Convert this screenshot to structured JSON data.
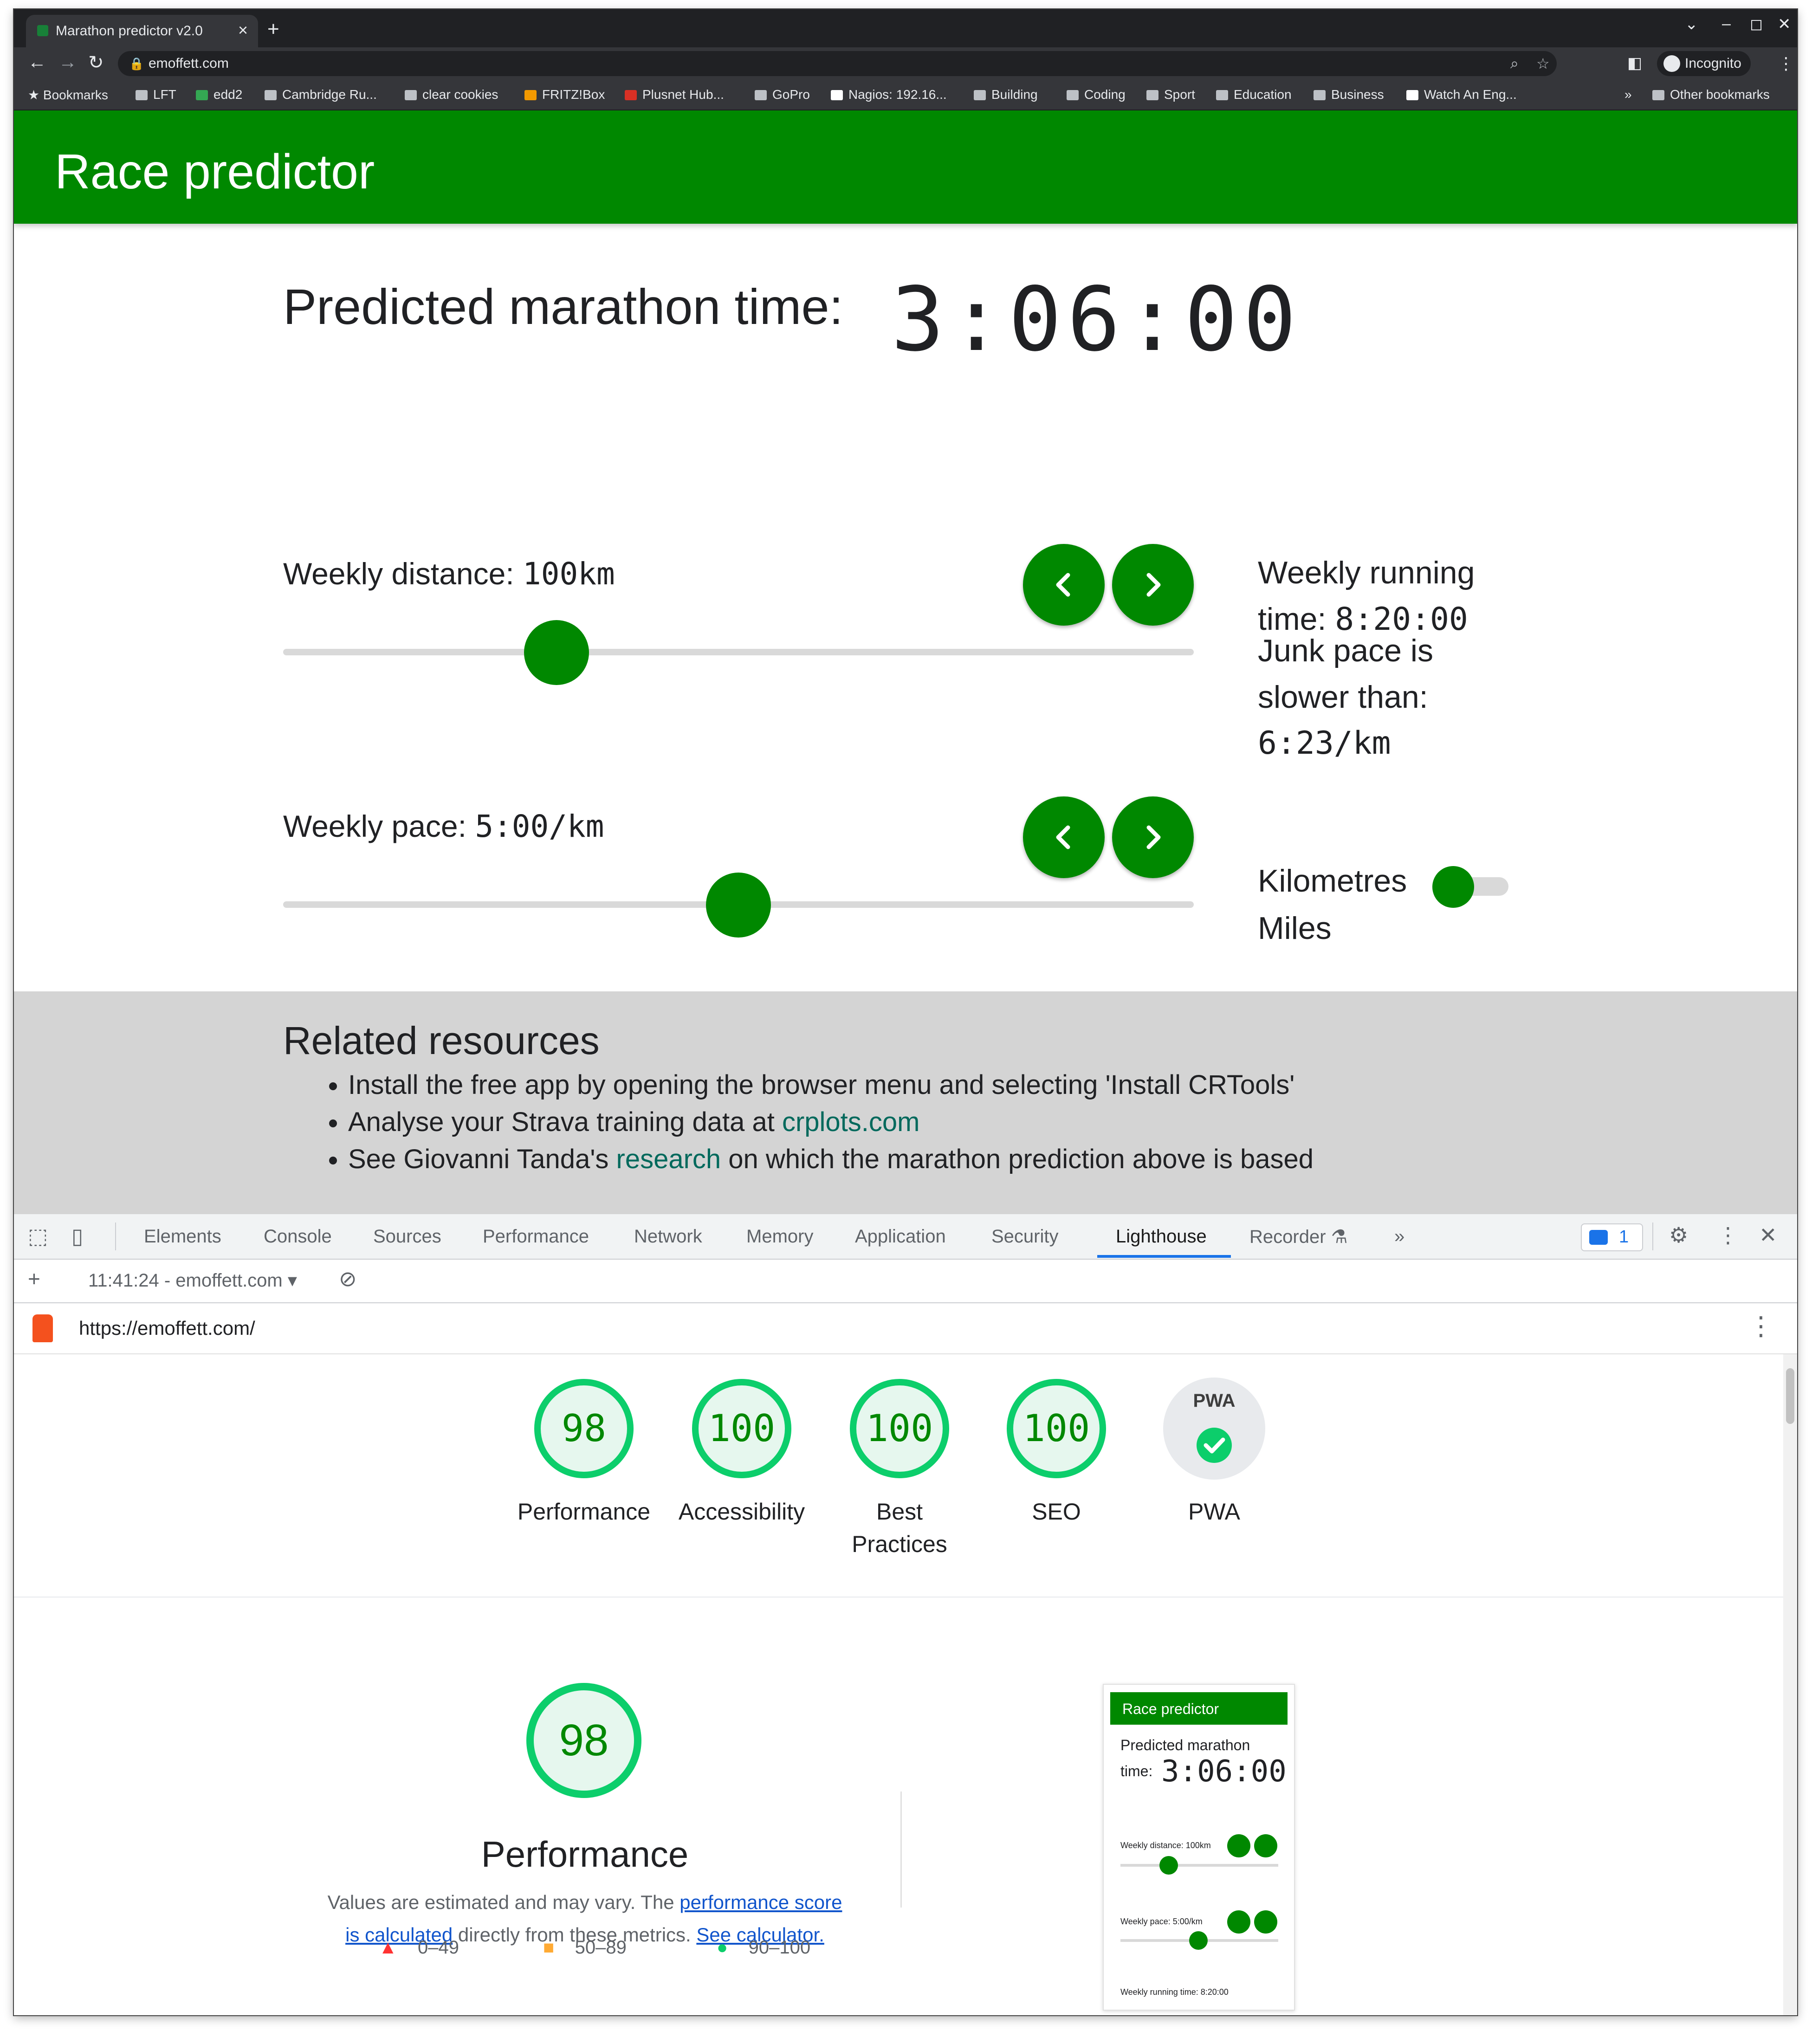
{
  "browser": {
    "tab_title": "Marathon predictor v2.0",
    "url": "emoffett.com",
    "incognito_label": "Incognito",
    "bookmarks": [
      "Bookmarks",
      "LFT",
      "edd2",
      "Cambridge Ru...",
      "clear cookies",
      "FRITZ!Box",
      "Plusnet Hub...",
      "GoPro",
      "Nagios: 192.16...",
      "Building",
      "Coding",
      "Sport",
      "Education",
      "Business",
      "Watch An Eng..."
    ],
    "overflow": "»",
    "other_bookmarks": "Other bookmarks"
  },
  "app": {
    "title": "Race predictor",
    "predicted_label": "Predicted marathon time:",
    "predicted_time": "3:06:00",
    "distance_label": "Weekly distance: ",
    "distance_value": "100km",
    "pace_label": "Weekly pace: ",
    "pace_value": "5:00/km",
    "distance_slider_fraction": 0.3,
    "pace_slider_fraction": 0.5,
    "running_time_label_1": "Weekly running",
    "running_time_label_2": "time: ",
    "running_time_value": "8:20:00",
    "junk_label_1": "Junk pace is",
    "junk_label_2": "slower than:",
    "junk_value": "6:23/km",
    "units_km": "Kilometres",
    "units_miles": "Miles",
    "accent_color": "#008800"
  },
  "related": {
    "heading": "Related resources",
    "item1": "Install the free app by opening the browser menu and selecting 'Install CRTools'",
    "item2_pre": "Analyse your Strava training data at ",
    "item2_link": "crplots.com",
    "item3_pre": "See Giovanni Tanda's ",
    "item3_link": "research",
    "item3_post": " on which the marathon prediction above is based"
  },
  "devtools": {
    "tabs": [
      "Elements",
      "Console",
      "Sources",
      "Performance",
      "Network",
      "Memory",
      "Application",
      "Security",
      "Lighthouse",
      "Recorder"
    ],
    "active_tab": "Lighthouse",
    "issues_count": "1",
    "report_select": "11:41:24 - emoffett.com",
    "report_url": "https://emoffett.com/"
  },
  "lighthouse": {
    "scores": [
      {
        "label": "Performance",
        "value": "98"
      },
      {
        "label": "Accessibility",
        "value": "100"
      },
      {
        "label": "Best Practices",
        "value": "100"
      },
      {
        "label": "SEO",
        "value": "100"
      }
    ],
    "pwa_label": "PWA",
    "pwa_badge": "PWA",
    "perf_score": "98",
    "perf_title": "Performance",
    "perf_desc_1": "Values are estimated and may vary. The ",
    "perf_link_1": "performance score is calculated",
    "perf_desc_2": " directly from these metrics. ",
    "perf_link_2": "See calculator.",
    "legend": [
      "0–49",
      "50–89",
      "90–100"
    ],
    "legend_colors": [
      "#ff3333",
      "#ffaa33",
      "#0cce6b"
    ]
  },
  "thumbnail": {
    "title": "Race predictor",
    "predicted_1": "Predicted marathon",
    "predicted_2": "time:",
    "time": "3:06:00",
    "distance": "Weekly distance: 100km",
    "pace": "Weekly pace: 5:00/km",
    "running": "Weekly running time: 8:20:00"
  }
}
